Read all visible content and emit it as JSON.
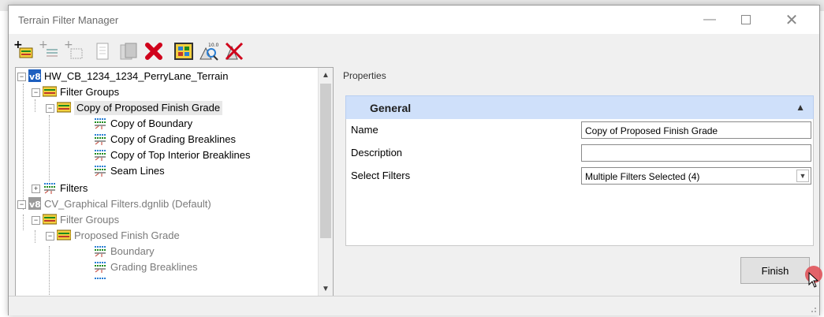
{
  "window": {
    "title": "Terrain Filter Manager"
  },
  "window_controls": [
    "minimize",
    "maximize",
    "close"
  ],
  "toolbar": {
    "buttons": [
      "new-filter-group-icon",
      "new-filter-icon",
      "new-empty-item-icon",
      "copy-icon",
      "paste-icon",
      "delete-icon",
      "select-all-icon",
      "zoom-terrain-icon",
      "clear-highlight-icon"
    ]
  },
  "tree": {
    "items": [
      {
        "label": "HW_CB_1234_1234_PerryLane_Terrain",
        "toggle": "−",
        "icon": "v8-file-icon"
      },
      {
        "label": "Filter Groups",
        "toggle": "−",
        "icon": "filter-group-icon"
      },
      {
        "label": "Copy of Proposed Finish Grade",
        "toggle": "−",
        "icon": "filter-group-icon"
      },
      {
        "label": "Copy of Boundary",
        "toggle": "",
        "icon": "filter-icon"
      },
      {
        "label": "Copy of Grading Breaklines",
        "toggle": "",
        "icon": "filter-icon"
      },
      {
        "label": "Copy of Top Interior Breaklines",
        "toggle": "",
        "icon": "filter-icon"
      },
      {
        "label": "Seam Lines",
        "toggle": "",
        "icon": "filter-icon"
      },
      {
        "label": "Filters",
        "toggle": "+",
        "icon": "filter-icon"
      },
      {
        "label": "CV_Graphical Filters.dgnlib (Default)",
        "toggle": "−",
        "icon": "v8-file-icon"
      },
      {
        "label": "Filter Groups",
        "toggle": "−",
        "icon": "filter-group-icon"
      },
      {
        "label": "Proposed Finish Grade",
        "toggle": "−",
        "icon": "filter-group-icon"
      },
      {
        "label": "Boundary",
        "toggle": "",
        "icon": "filter-icon"
      },
      {
        "label": "Grading Breaklines",
        "toggle": "",
        "icon": "filter-icon"
      }
    ]
  },
  "properties": {
    "section_label": "Properties",
    "group_title": "General",
    "name_label": "Name",
    "name_value": "Copy of Proposed Finish Grade",
    "description_label": "Description",
    "description_value": "",
    "select_filters_label": "Select Filters",
    "select_filters_value": "Multiple Filters Selected (4)"
  },
  "finish_label": "Finish",
  "colors": {
    "accent_header": "#cfe0fa",
    "delete_red": "#d0021b",
    "cursor_red": "#e0535a"
  }
}
